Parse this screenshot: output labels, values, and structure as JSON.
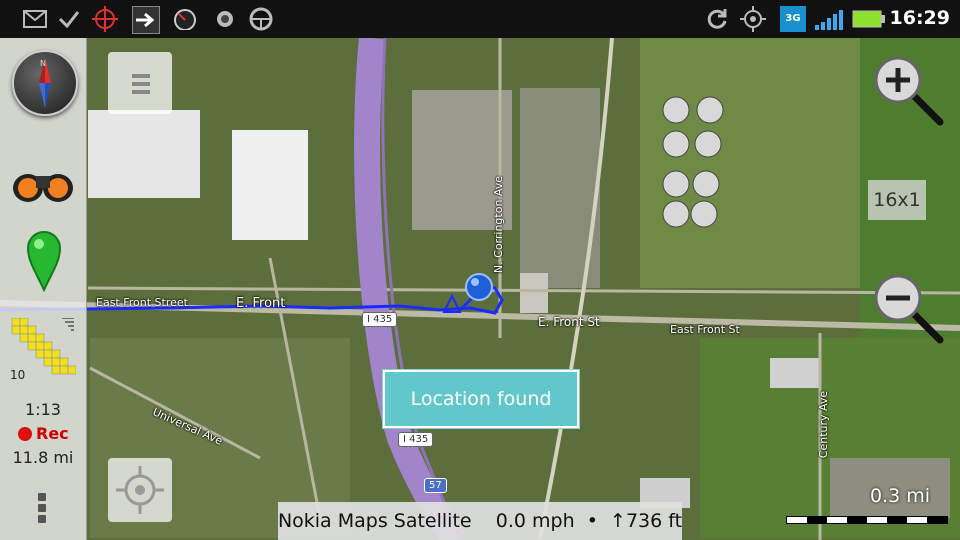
{
  "status_bar": {
    "time": "16:29",
    "network": "3G",
    "icons": [
      "gmail-icon",
      "check-icon",
      "crosshair-icon",
      "arrow-right-icon",
      "speedometer-icon",
      "record-icon",
      "steering-wheel-icon",
      "sync-icon",
      "gps-icon",
      "signal-icon",
      "battery-icon"
    ]
  },
  "left_panel": {
    "trip_time": "1:13",
    "rec_label": "Rec",
    "distance": "11.8 mi",
    "level": "10"
  },
  "map": {
    "zoom_level": "16x1",
    "toast": "Location found",
    "roads": {
      "east_front_street": "East Front Street",
      "e_front": "E. Front",
      "e_front_st": "E. Front St",
      "east_front_st": "East Front St",
      "n_corrington": "North Corrington Ave",
      "corrington_ave": "N. Corrington Ave",
      "universal_ave": "Universal Ave",
      "century_ave": "Century Ave",
      "i435": "I 435",
      "shield_57": "57"
    }
  },
  "info_bar": {
    "source": "Nokia Maps Satellite",
    "speed": "0.0 mph",
    "separator": "•",
    "altitude": "↑736 ft"
  },
  "scale": {
    "label": "0.3 mi"
  },
  "colors": {
    "track": "#1a2cff",
    "highway": "#a184c9",
    "toast": "#62c7cb",
    "rec": "#e01010"
  }
}
